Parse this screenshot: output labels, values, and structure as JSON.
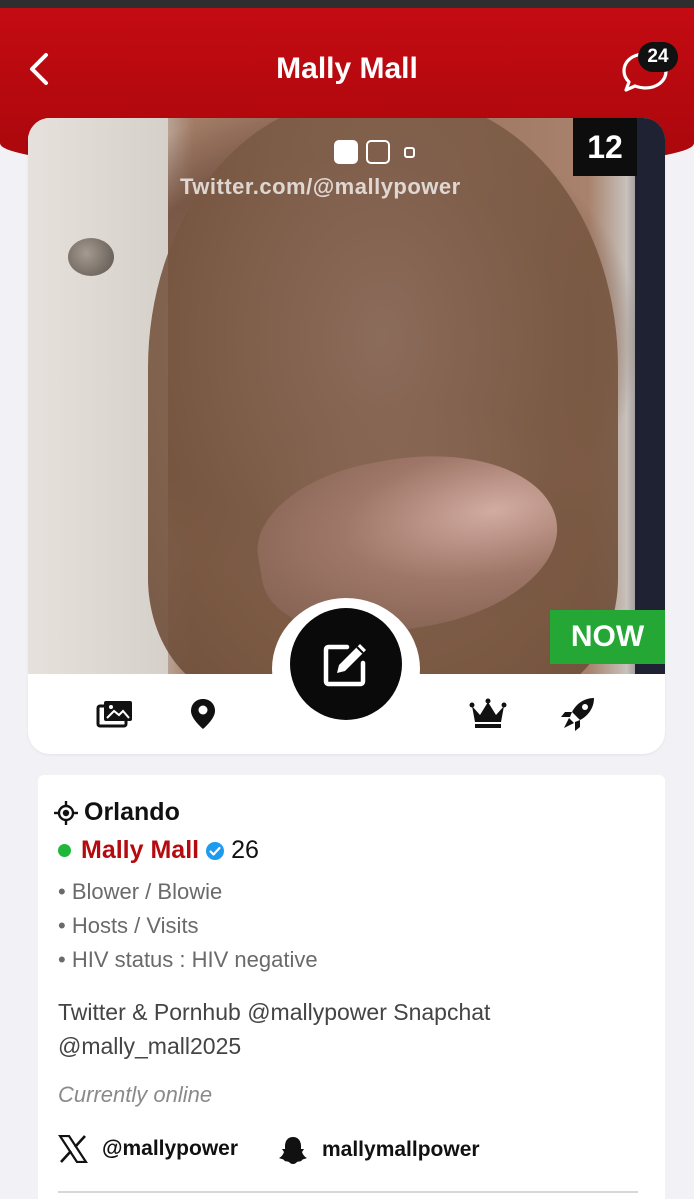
{
  "header": {
    "title": "Mally Mall",
    "message_count": "24",
    "accent_color": "#b50b10"
  },
  "photo": {
    "watermark": "Twitter.com/@mallypower",
    "photo_count": "12",
    "status_badge": "NOW",
    "gallery_position": {
      "current": 1,
      "total": 3
    }
  },
  "icon_bar": {
    "icons": [
      "photos-icon",
      "location-pin-icon",
      "edit-icon",
      "crown-icon",
      "rocket-icon"
    ]
  },
  "profile": {
    "city": "Orlando",
    "name": "Mally Mall",
    "age": "26",
    "online_color": "#1fb83a",
    "details": [
      "• Blower / Blowie",
      "• Hosts / Visits",
      "• HIV status : HIV negative"
    ],
    "bio": "Twitter & Pornhub @mallypower Snapchat @mally_mall2025",
    "status": "Currently online",
    "social": {
      "x_handle": "@mallypower",
      "snapchat_handle": "mallymallpower"
    }
  }
}
